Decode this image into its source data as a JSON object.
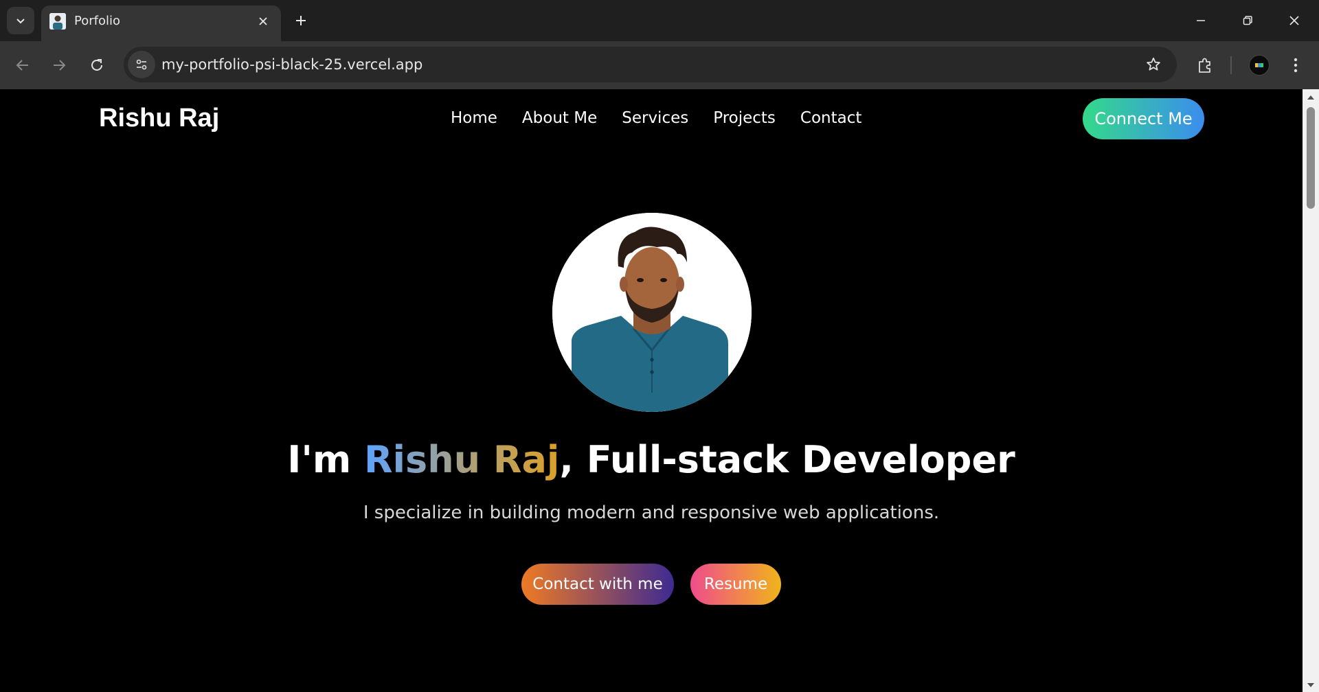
{
  "browser": {
    "tab_title": "Porfolio",
    "url": "my-portfolio-psi-black-25.vercel.app",
    "icons": {
      "tab_search": "chevron-down-icon",
      "tab_close": "close-icon",
      "new_tab": "plus-icon",
      "minimize": "minimize-icon",
      "restore": "restore-icon",
      "close_window": "close-icon",
      "back": "arrow-left-icon",
      "forward": "arrow-right-icon",
      "reload": "reload-icon",
      "site_info": "tune-icon",
      "bookmark": "star-icon",
      "extensions": "puzzle-icon",
      "menu": "kebab-menu-icon"
    },
    "colors": {
      "tabbar": "#1f1f1f",
      "active_tab": "#353535",
      "omnibox": "#282828"
    }
  },
  "site": {
    "logo": "Rishu Raj",
    "nav": [
      "Home",
      "About Me",
      "Services",
      "Projects",
      "Contact"
    ],
    "connect_button": "Connect Me",
    "hero": {
      "intro_prefix": "I'm ",
      "name": "Rishu Raj",
      "intro_suffix": ", Full-stack Developer",
      "subtitle": "I specialize in building modern and responsive web applications.",
      "primary_cta": "Contact with me",
      "secondary_cta": "Resume"
    },
    "colors": {
      "background": "#000000",
      "connect_gradient": [
        "#34d98a",
        "#3a8dee"
      ],
      "name_gradient": [
        "#5da3ff",
        "#dca028"
      ],
      "contact_gradient": [
        "#ee7a24",
        "#3e2a92"
      ],
      "resume_gradient": [
        "#ef4c8c",
        "#f0b41a"
      ]
    }
  }
}
